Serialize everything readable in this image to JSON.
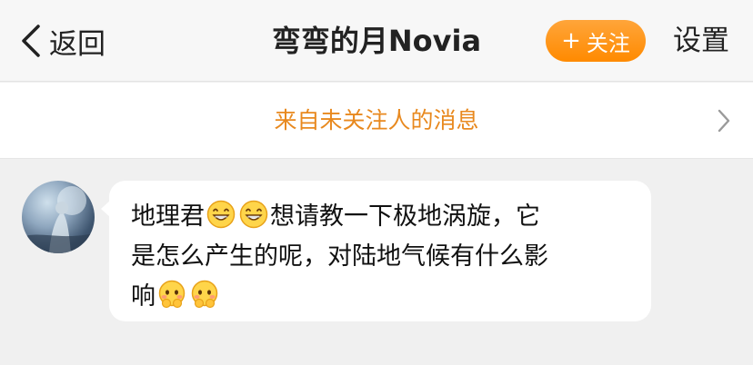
{
  "header": {
    "back_label": "返回",
    "title": "弯弯的月Novia",
    "follow_plus": "+",
    "follow_label": "关注",
    "settings_label": "设置"
  },
  "notice": {
    "text": "来自未关注人的消息"
  },
  "message": {
    "line1_a": "地理君",
    "line1_b": "想请教一下极地涡旋，它",
    "line2": "是怎么产生的呢，对陆地气候有什么影",
    "line3": "响",
    "emoji_1": "grin-emoji",
    "emoji_2": "shy-emoji"
  },
  "colors": {
    "accent": "#ff8a00",
    "notice_text": "#e8891f"
  }
}
